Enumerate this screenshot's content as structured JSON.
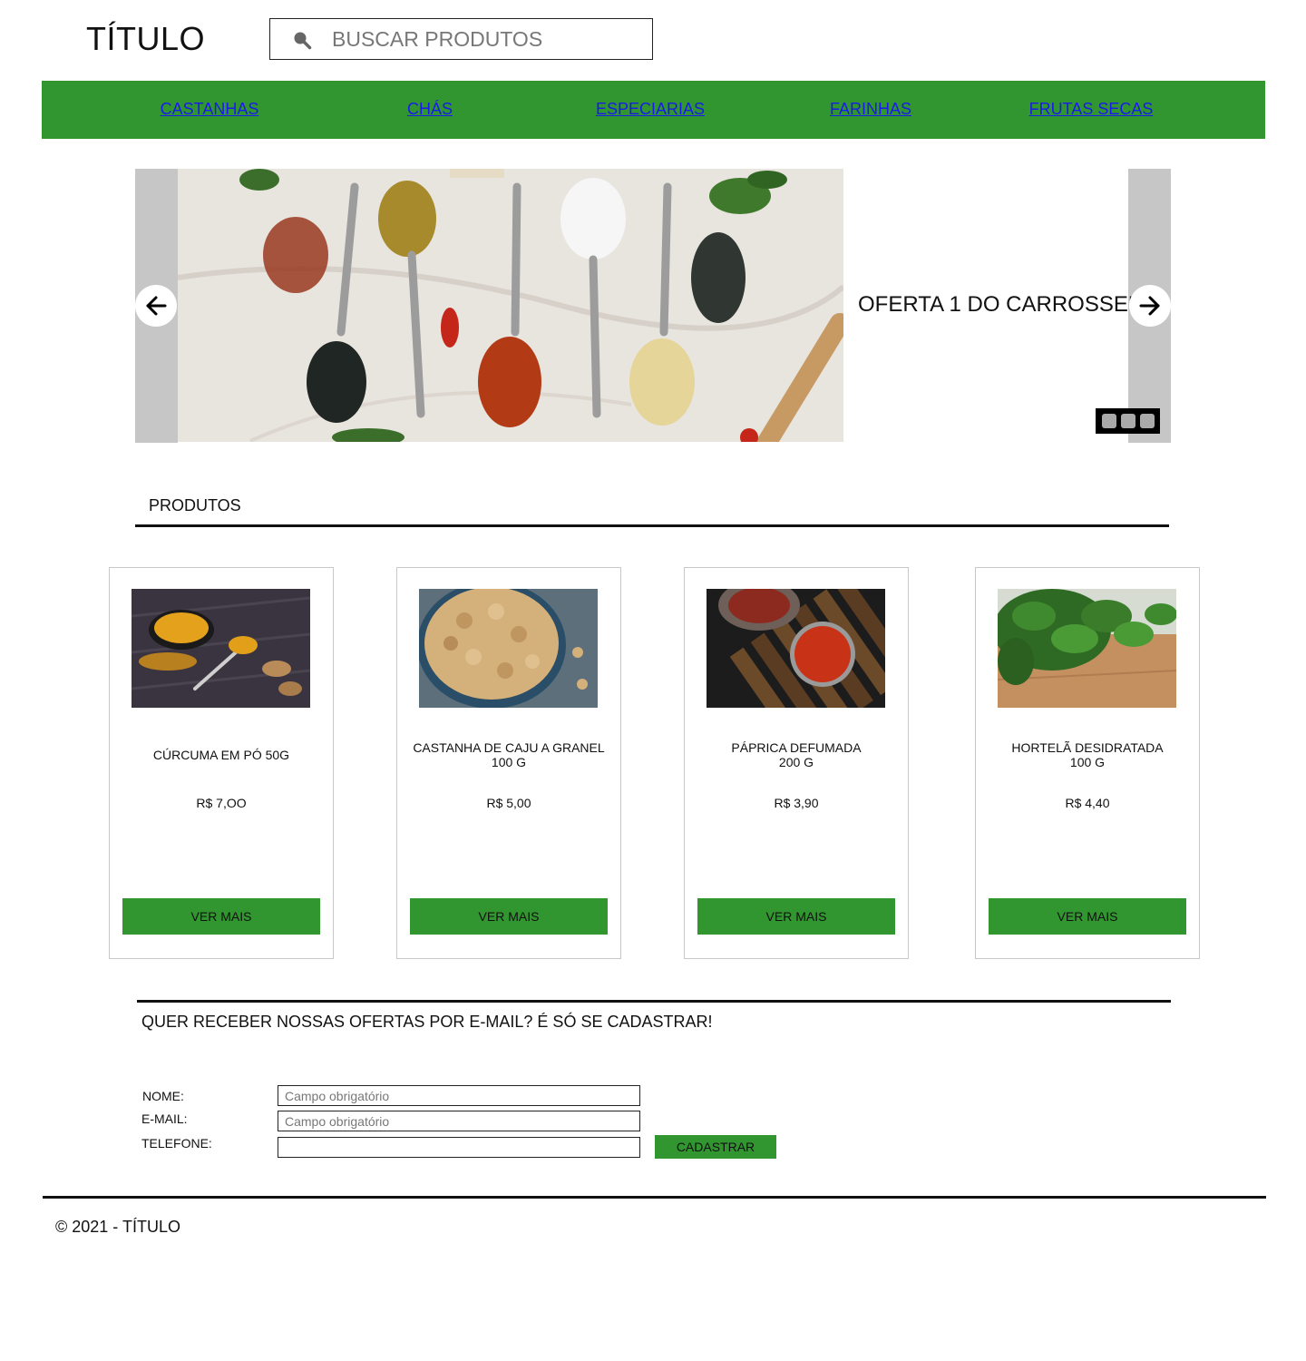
{
  "header": {
    "title": "TÍTULO",
    "search": {
      "placeholder": "BUSCAR PRODUTOS",
      "icon": "search-icon"
    }
  },
  "nav": {
    "background": "#31962f",
    "items": [
      {
        "label": "CASTANHAS"
      },
      {
        "label": "CHÁS"
      },
      {
        "label": "ESPECIARIAS"
      },
      {
        "label": "FARINHAS"
      },
      {
        "label": "FRUTAS SECAS"
      }
    ]
  },
  "carousel": {
    "offer_text": "OFERTA 1 DO CARROSSEL",
    "prev_icon": "arrow-left-icon",
    "next_icon": "arrow-right-icon",
    "indicator_count": 3
  },
  "products_section": {
    "title": "PRODUTOS",
    "items": [
      {
        "name": "CÚRCUMA EM PÓ 50G",
        "price": "R$ 7,OO",
        "button": "VER MAIS"
      },
      {
        "name": "CASTANHA DE CAJU A GRANEL\n100 G",
        "price": "R$ 5,00",
        "button": "VER MAIS"
      },
      {
        "name": "PÁPRICA DEFUMADA\n200 G",
        "price": "R$ 3,90",
        "button": "VER MAIS"
      },
      {
        "name": "HORTELÃ DESIDRATADA\n100 G",
        "price": "R$ 4,40",
        "button": "VER MAIS"
      }
    ]
  },
  "newsletter": {
    "title": "QUER RECEBER NOSSAS OFERTAS POR E-MAIL? É SÓ SE CADASTRAR!",
    "fields": [
      {
        "label": "NOME:",
        "placeholder": "Campo obrigatório"
      },
      {
        "label": "E-MAIL:",
        "placeholder": "Campo obrigatório"
      },
      {
        "label": "TELEFONE:",
        "placeholder": ""
      }
    ],
    "submit": "CADASTRAR"
  },
  "footer": {
    "text": "© 2021 - TÍTULO"
  },
  "colors": {
    "accent": "#31962f",
    "link": "#1a1aee",
    "carousel_strip": "#c6c6c6"
  }
}
